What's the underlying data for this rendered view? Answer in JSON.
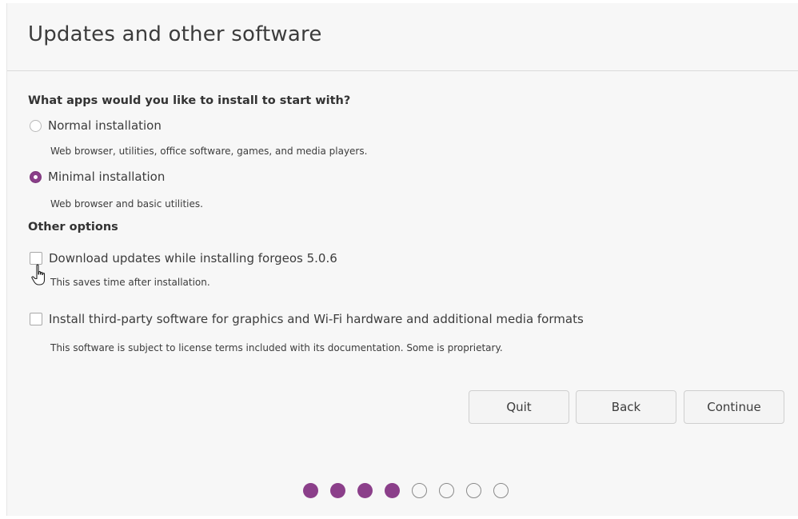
{
  "header": {
    "title": "Updates and other software"
  },
  "apps_section": {
    "label": "What apps would you like to install to start with?",
    "options": [
      {
        "label": "Normal installation",
        "description": "Web browser, utilities, office software, games, and media players.",
        "selected": false
      },
      {
        "label": "Minimal installation",
        "description": "Web browser and basic utilities.",
        "selected": true
      }
    ]
  },
  "other_section": {
    "label": "Other options",
    "options": [
      {
        "label": "Download updates while installing forgeos 5.0.6",
        "description": "This saves time after installation.",
        "checked": false
      },
      {
        "label": "Install third-party software for graphics and Wi-Fi hardware and additional media formats",
        "description": "This software is subject to license terms included with its documentation. Some is proprietary.",
        "checked": false
      }
    ]
  },
  "buttons": {
    "quit": "Quit",
    "back": "Back",
    "continue": "Continue"
  },
  "progress": {
    "total_steps": 8,
    "completed_steps": 4
  },
  "colors": {
    "accent": "#8b3f8a",
    "background": "#f7f7f7",
    "text": "#3c3c3c"
  },
  "icons": {
    "cursor": "hand-pointer-icon"
  }
}
